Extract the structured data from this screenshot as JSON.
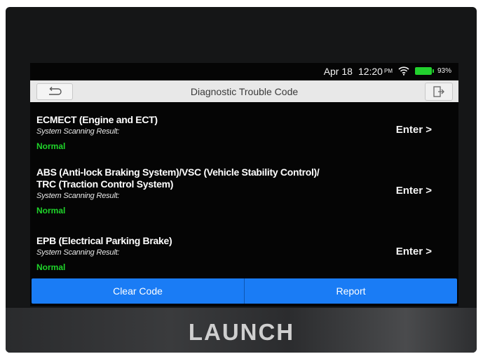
{
  "status_bar": {
    "date": "Apr 18",
    "time": "12:20",
    "ampm": "PM",
    "battery": "93%"
  },
  "header": {
    "title": "Diagnostic Trouble Code",
    "back_icon": "back-arrow-icon",
    "exit_icon": "exit-icon"
  },
  "systems": [
    {
      "name_lines": [
        "ECMECT (Engine and ECT)"
      ],
      "result_label": "System Scanning Result:",
      "status": "Normal",
      "enter": "Enter >"
    },
    {
      "name_lines": [
        "ABS (Anti-lock Braking System)/VSC (Vehicle Stability Control)/",
        "TRC (Traction Control System)"
      ],
      "result_label": "System Scanning Result:",
      "status": "Normal",
      "enter": "Enter >"
    },
    {
      "name_lines": [
        "EPB (Electrical Parking Brake)"
      ],
      "result_label": "System Scanning Result:",
      "status": "Normal",
      "enter": "Enter >"
    }
  ],
  "actions": {
    "clear": "Clear Code",
    "report": "Report"
  },
  "device": {
    "brand": "LAUNCH"
  },
  "colors": {
    "accent": "#1a7cf5",
    "status_normal": "#1fd42a"
  }
}
